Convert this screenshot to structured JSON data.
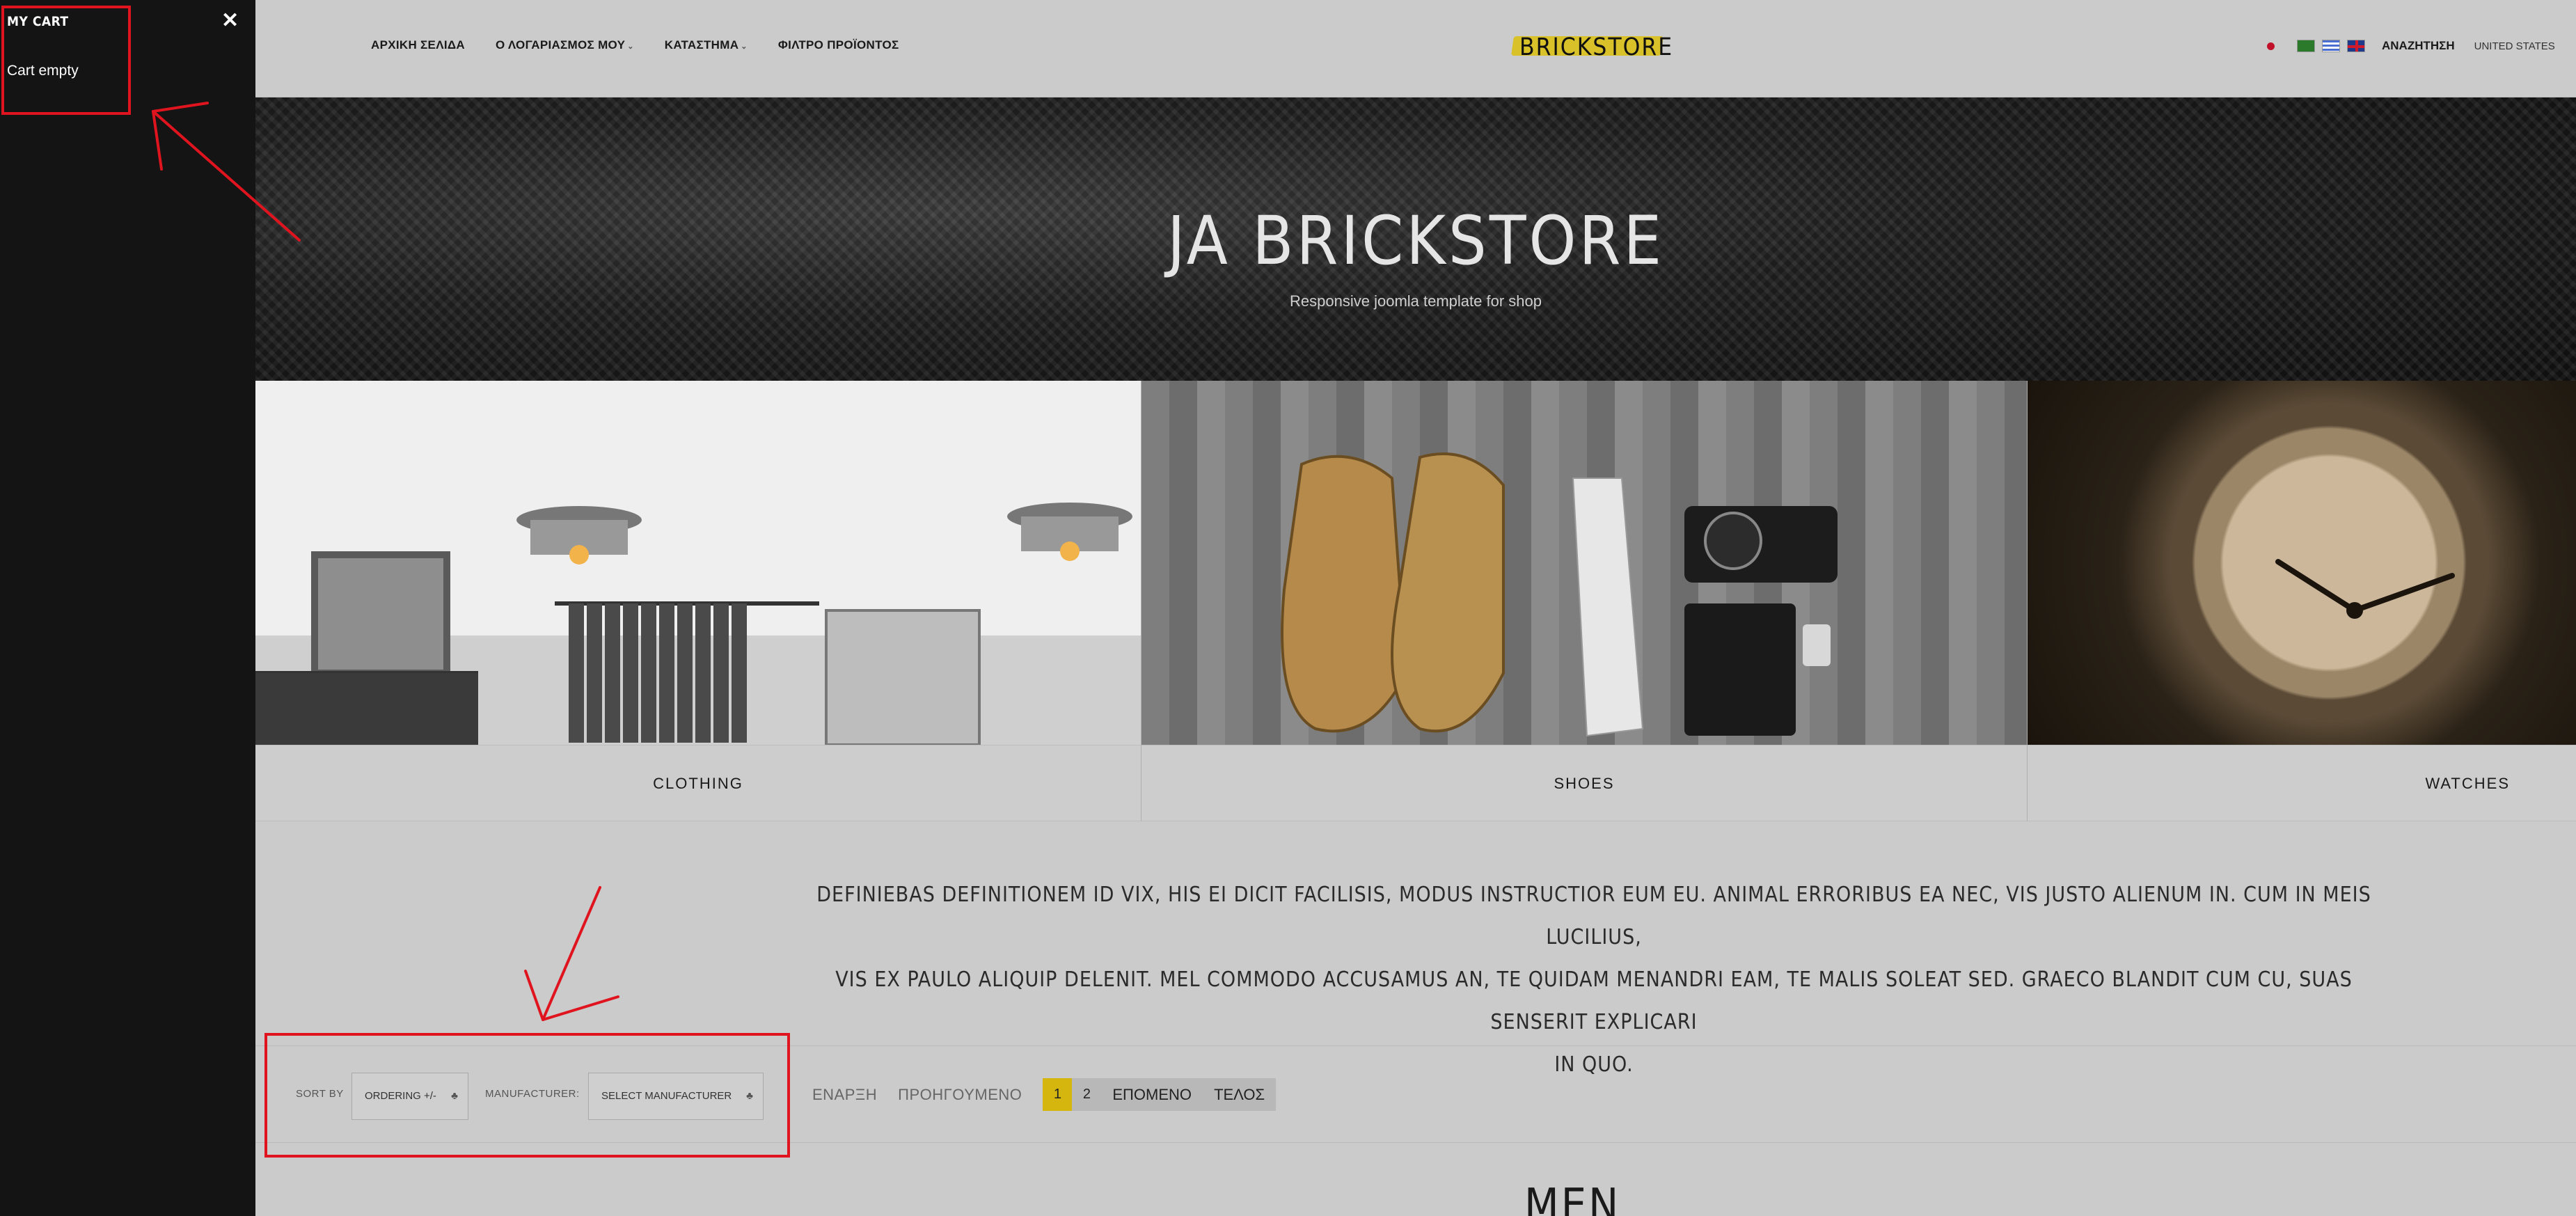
{
  "sidebar": {
    "cart_title": "MY CART",
    "close_glyph": "✕",
    "cart_status": "Cart empty"
  },
  "header": {
    "nav": [
      {
        "label": "ΑΡΧΙΚΗ ΣΕΛΙΔΑ",
        "has_caret": false
      },
      {
        "label": "Ο ΛΟΓΑΡΙΑΣΜΟΣ ΜΟΥ",
        "has_caret": true
      },
      {
        "label": "ΚΑΤΑΣΤΗΜΑ",
        "has_caret": true
      },
      {
        "label": "ΦΙΛΤΡΟ ΠΡΟΪΟΝΤΟΣ",
        "has_caret": false
      }
    ],
    "logo_text": "BRICKSTORE",
    "search_label": "ΑΝΑΖΗΤΗΣΗ",
    "country_label": "UNITED STATES"
  },
  "hero": {
    "title": "JA BRICKSTORE",
    "subtitle": "Responsive joomla template for shop"
  },
  "categories": [
    {
      "label": "CLOTHING"
    },
    {
      "label": "SHOES"
    },
    {
      "label": "WATCHES"
    }
  ],
  "description": {
    "line1": "DEFINIEBAS DEFINITIONEM ID VIX, HIS EI DICIT FACILISIS, MODUS INSTRUCTIOR EUM EU. ANIMAL ERRORIBUS EA NEC, VIS JUSTO ALIENUM IN. CUM IN MEIS LUCILIUS,",
    "line2": "VIS EX PAULO ALIQUIP DELENIT. MEL COMMODO ACCUSAMUS AN, TE QUIDAM MENANDRI EAM, TE MALIS SOLEAT SED. GRAECO BLANDIT CUM CU, SUAS SENSERIT EXPLICARI",
    "line3": "IN QUO."
  },
  "toolbar": {
    "sort_by_label": "SORT BY",
    "sort_value": "ORDERING +/-",
    "manufacturer_label": "MANUFACTURER:",
    "manufacturer_value": "SELECT MANUFACTURER",
    "pager": {
      "start": "ΕΝΑΡΞΗ",
      "prev": "ΠΡΟΗΓΟΥΜΕΝΟ",
      "current": "1",
      "page2": "2",
      "next": "ΕΠΟΜΕΝΟ",
      "last": "ΤΕΛΟΣ"
    }
  },
  "section_heading": "MEN",
  "colors": {
    "accent_yellow": "#d4b60e",
    "annotation_red": "#e0141e",
    "sidebar_bg": "#141414"
  }
}
